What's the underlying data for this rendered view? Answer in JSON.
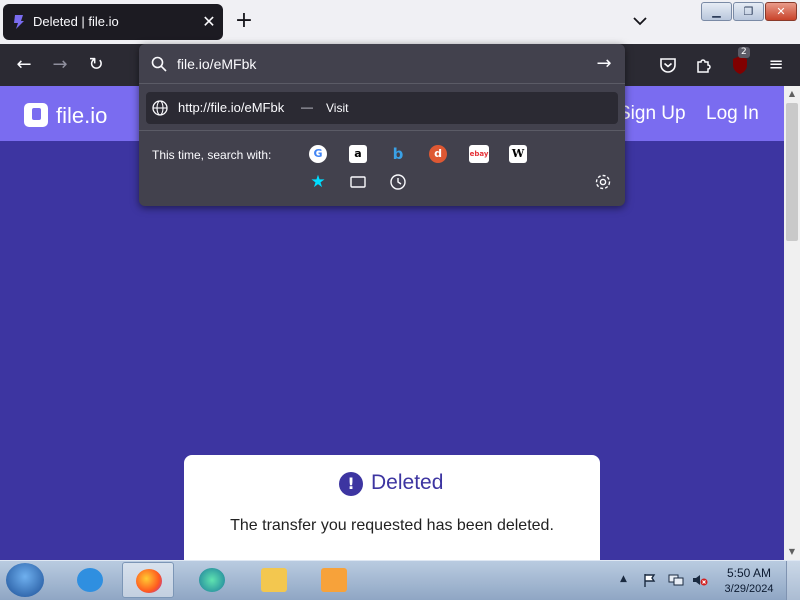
{
  "browser": {
    "tab": {
      "title": "Deleted | file.io"
    },
    "urlbar": {
      "typed_value": "file.io/eMFbk",
      "result_url": "http://file.io/eMFbk",
      "result_separator": "—",
      "result_action": "Visit",
      "search_with_label": "This time, search with:",
      "engines": [
        "Google",
        "Amazon",
        "Bing",
        "DuckDuckGo",
        "eBay",
        "Wikipedia"
      ],
      "extension_badge": "2"
    }
  },
  "site": {
    "brand": "file.io",
    "nav": {
      "signup": "Sign Up",
      "login": "Log In"
    },
    "card": {
      "title": "Deleted",
      "message": "The transfer you requested has been deleted."
    },
    "colors": {
      "page_bg": "#3d35a1",
      "header_bg": "#7a6cf0"
    }
  },
  "taskbar": {
    "time": "5:50 AM",
    "date": "3/29/2024",
    "apps": [
      "internet-explorer",
      "firefox",
      "edge",
      "file-explorer",
      "media-player"
    ]
  }
}
